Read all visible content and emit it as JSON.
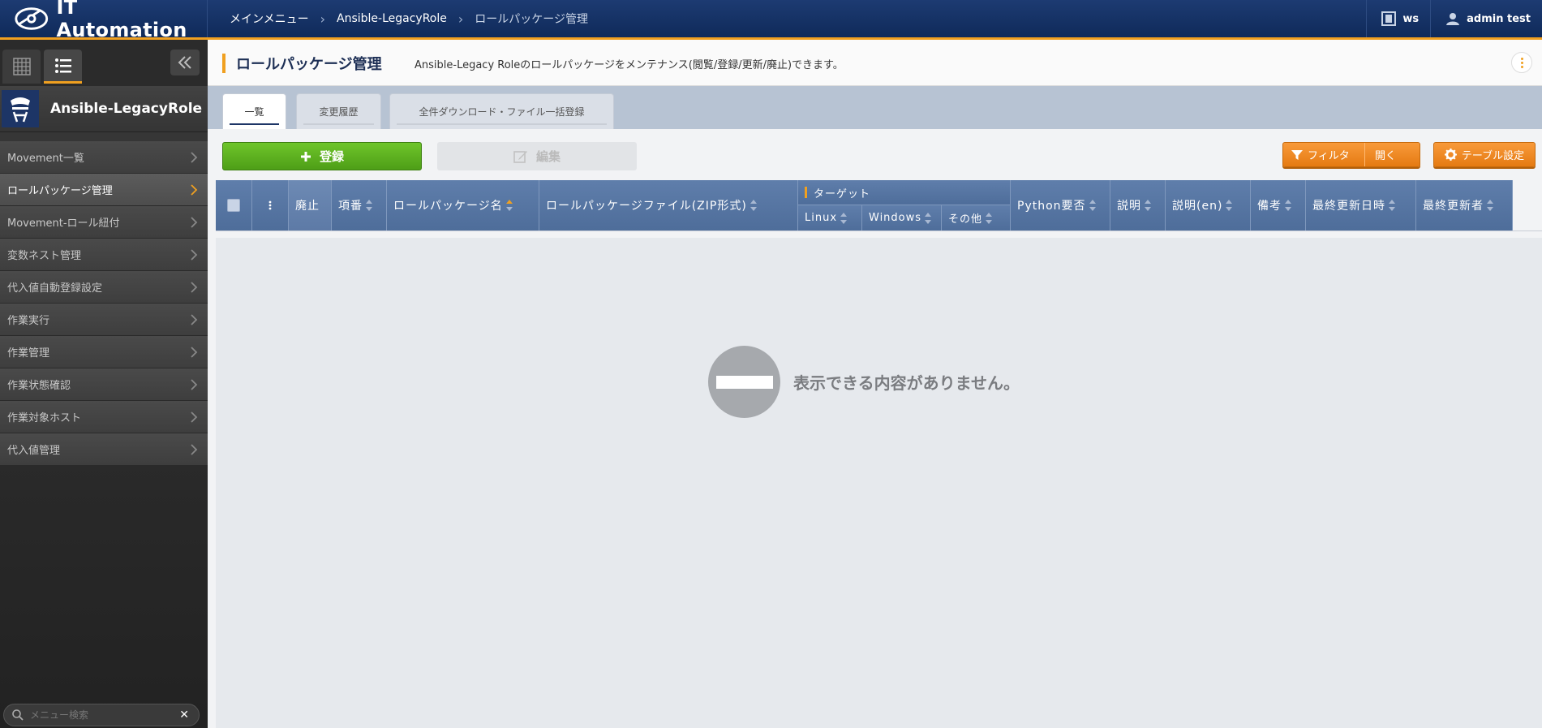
{
  "app": {
    "title": "IT Automation"
  },
  "breadcrumb": [
    "メインメニュー",
    "Ansible-LegacyRole",
    "ロールパッケージ管理"
  ],
  "header_right": {
    "workspace": "ws",
    "user": "admin test"
  },
  "sidebar": {
    "title": "Ansible-LegacyRole",
    "items": [
      {
        "label": "Movement一覧"
      },
      {
        "label": "ロールパッケージ管理"
      },
      {
        "label": "Movement-ロール紐付"
      },
      {
        "label": "変数ネスト管理"
      },
      {
        "label": "代入値自動登録設定"
      },
      {
        "label": "作業実行"
      },
      {
        "label": "作業管理"
      },
      {
        "label": "作業状態確認"
      },
      {
        "label": "作業対象ホスト"
      },
      {
        "label": "代入値管理"
      }
    ],
    "search_placeholder": "メニュー検索"
  },
  "page": {
    "title": "ロールパッケージ管理",
    "description": "Ansible-Legacy Roleのロールパッケージをメンテナンス(閲覧/登録/更新/廃止)できます。"
  },
  "tabs": [
    {
      "label": "一覧"
    },
    {
      "label": "変更履歴"
    },
    {
      "label": "全件ダウンロード・ファイル一括登録"
    }
  ],
  "toolbar": {
    "register": "登録",
    "edit": "編集",
    "filter": "フィルタ",
    "filter_open": "開く",
    "table_settings": "テーブル設定"
  },
  "table": {
    "columns": {
      "discard": "廃止",
      "item_no": "項番",
      "role_package_name": "ロールパッケージ名",
      "role_package_file": "ロールパッケージファイル(ZIP形式)",
      "target_group": "ターゲット",
      "linux": "Linux",
      "windows": "Windows",
      "other": "その他",
      "python": "Python要否",
      "description": "説明",
      "description_en": "説明(en)",
      "remarks": "備考",
      "last_updated": "最終更新日時",
      "last_updated_by": "最終更新者"
    },
    "empty_message": "表示できる内容がありません。"
  },
  "colors": {
    "accent": "#f0a020",
    "header": "#1d3b72",
    "register": "#5cb31f",
    "orange": "#f08a24"
  }
}
